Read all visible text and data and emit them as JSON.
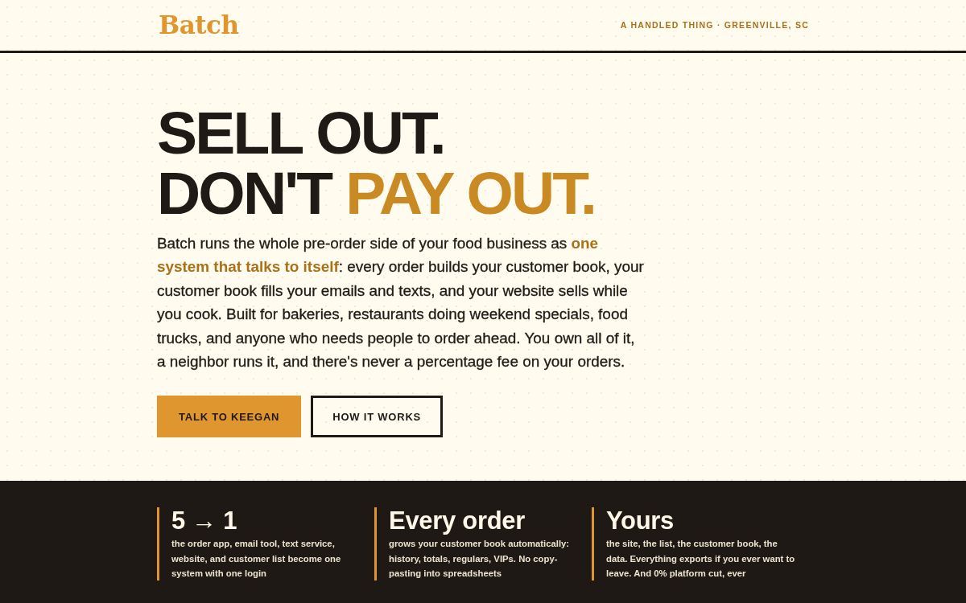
{
  "header": {
    "logo": "Batch",
    "tagline": "A HANDLED THING · GREENVILLE, SC"
  },
  "hero": {
    "headline": [
      [
        {
          "text": "SELL OUT.",
          "accent": false
        }
      ],
      [
        {
          "text": "DON'T",
          "accent": false
        },
        {
          "text": "PAY OUT.",
          "accent": true
        }
      ]
    ],
    "description": "Batch runs the whole pre-order side of your food business as **one system that talks to itself**: every order builds your customer book, your customer book fills your emails and texts, and your website sells while you cook. Built for bakeries, restaurants doing weekend specials, food trucks, and anyone who needs people to order ahead. You own all of it, a neighbor runs it, and there's never a percentage fee on your orders.",
    "buttons": [
      {
        "label": "TALK TO KEEGAN",
        "kind": "primary"
      },
      {
        "label": "HOW IT WORKS",
        "kind": "outline"
      }
    ]
  },
  "stats": [
    {
      "title": "5 → 1",
      "text": "the order app, email tool, text service, website, and customer list become one system with one login"
    },
    {
      "title": "Every order",
      "text": "grows your customer book automatically: history, totals, regulars, VIPs. No copy-pasting into spreadsheets"
    },
    {
      "title": "Yours",
      "text": "the site, the list, the customer book, the data. Everything exports if you ever want to leave. And 0% platform cut, ever"
    }
  ]
}
